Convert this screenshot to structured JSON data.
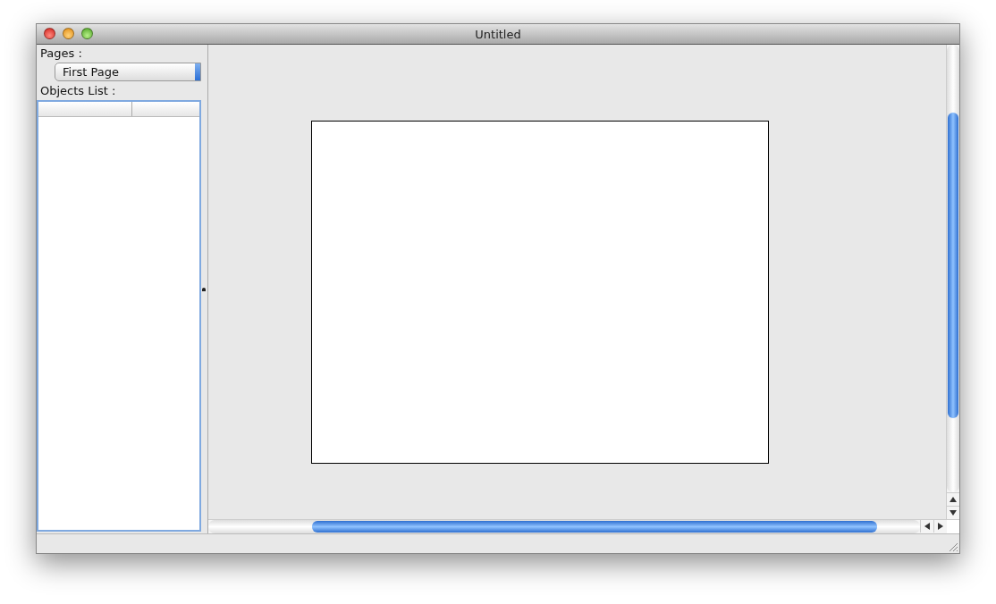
{
  "window": {
    "title": "Untitled"
  },
  "pages": {
    "label": "Pages :",
    "value": "First Page"
  },
  "objects_list": {
    "label": "Objects List :"
  }
}
